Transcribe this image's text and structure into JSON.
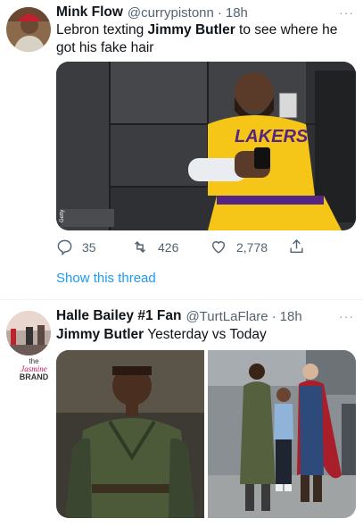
{
  "tweet1": {
    "name": "Mink Flow",
    "handle": "@currypistonn",
    "sep": "·",
    "time": "18h",
    "more": "···",
    "text_part1": "Lebron texting ",
    "text_bold": "Jimmy Butler",
    "text_part2": " to see where he got his fake hair",
    "image_caption": "Getty",
    "actions": {
      "replies": "35",
      "retweets": "426",
      "likes": "2,778"
    },
    "show_thread": "Show this thread"
  },
  "tweet2": {
    "name": "Halle Bailey #1 Fan",
    "handle": "@TurtLaFlare",
    "sep": "·",
    "time": "18h",
    "more": "···",
    "text_bold": "Jimmy Butler",
    "text_rest": " Yesterday vs Today"
  },
  "watermark": {
    "line1": "the",
    "line2": "Jasmine",
    "line3": "BRAND"
  },
  "colors": {
    "link": "#1d9bf0",
    "secondary": "#536471",
    "lakers_gold": "#f5c518",
    "lakers_purple": "#552583"
  }
}
